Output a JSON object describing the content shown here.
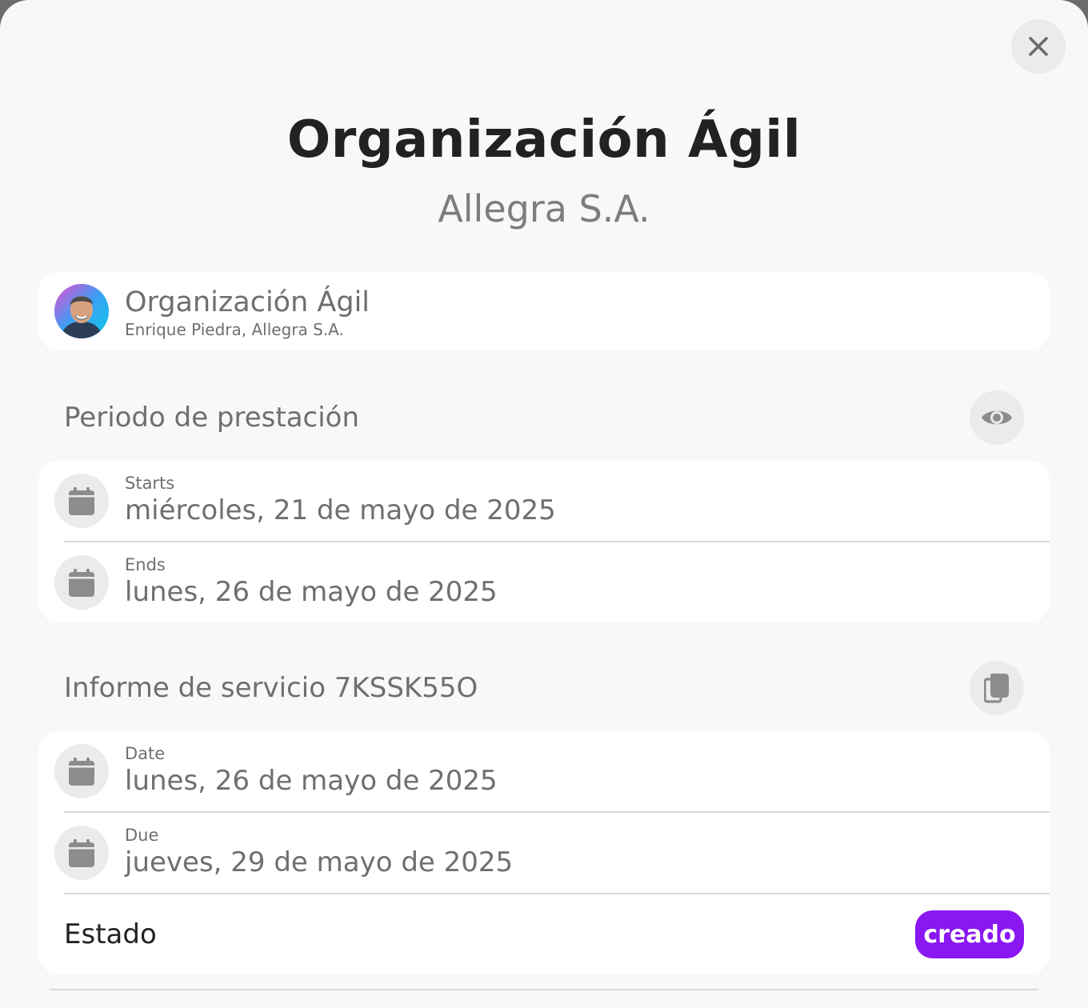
{
  "header": {
    "title": "Organización Ágil",
    "subtitle": "Allegra S.A."
  },
  "project": {
    "name": "Organización Ágil",
    "people": "Enrique Piedra, Allegra S.A."
  },
  "period": {
    "title": "Periodo de prestación",
    "starts_label": "Starts",
    "starts_value": "miércoles, 21 de mayo de 2025",
    "ends_label": "Ends",
    "ends_value": "lunes, 26 de mayo de 2025"
  },
  "report": {
    "title": "Informe de servicio 7KSSK55O",
    "date_label": "Date",
    "date_value": "lunes, 26 de mayo de 2025",
    "due_label": "Due",
    "due_value": "jueves, 29 de mayo de 2025",
    "status_label": "Estado",
    "status_value": "creado"
  },
  "colors": {
    "status_badge": "#8a16f2",
    "icon_gray": "#8c8c8c"
  },
  "icons": {
    "close": "close-icon",
    "view": "eye-icon",
    "copy": "copy-icon",
    "date": "calendar-icon"
  }
}
